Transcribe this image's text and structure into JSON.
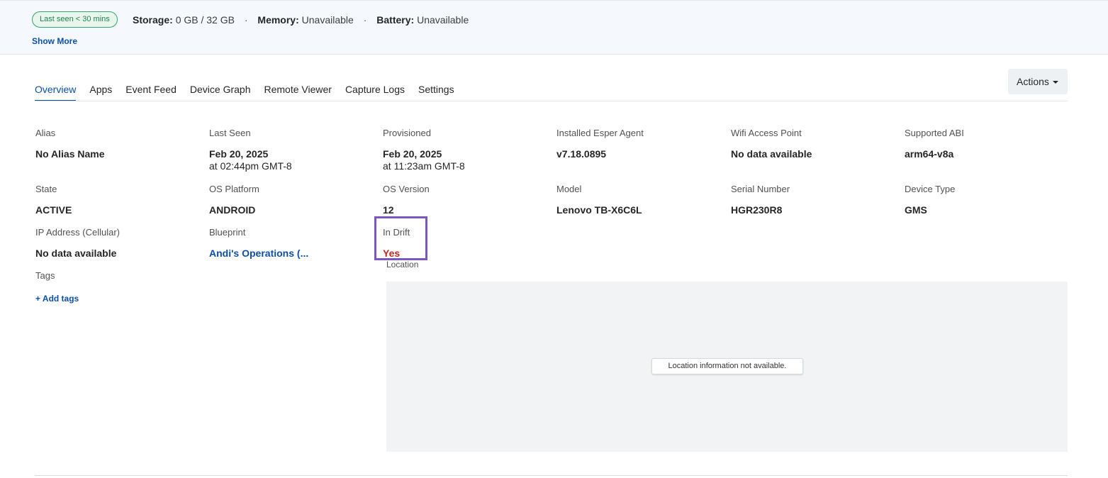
{
  "status_bar": {
    "badge": "Last seen < 30 mins",
    "storage_label": "Storage:",
    "storage_value": "0 GB / 32 GB",
    "memory_label": "Memory:",
    "memory_value": "Unavailable",
    "battery_label": "Battery:",
    "battery_value": "Unavailable",
    "separator": "·",
    "show_more": "Show More"
  },
  "tabs": [
    {
      "label": "Overview",
      "active": true
    },
    {
      "label": "Apps"
    },
    {
      "label": "Event Feed"
    },
    {
      "label": "Device Graph"
    },
    {
      "label": "Remote Viewer"
    },
    {
      "label": "Capture Logs"
    },
    {
      "label": "Settings"
    }
  ],
  "actions_label": "Actions",
  "details": {
    "alias": {
      "label": "Alias",
      "value": "No Alias Name"
    },
    "last_seen": {
      "label": "Last Seen",
      "value": "Feb 20, 2025",
      "sub": "at 02:44pm GMT-8"
    },
    "provisioned": {
      "label": "Provisioned",
      "value": "Feb 20, 2025",
      "sub": "at 11:23am GMT-8"
    },
    "agent": {
      "label": "Installed Esper Agent",
      "value": "v7.18.0895"
    },
    "wifi": {
      "label": "Wifi Access Point",
      "value": "No data available"
    },
    "abi": {
      "label": "Supported ABI",
      "value": "arm64-v8a"
    },
    "state": {
      "label": "State",
      "value": "ACTIVE"
    },
    "os_platform": {
      "label": "OS Platform",
      "value": "ANDROID"
    },
    "os_version": {
      "label": "OS Version",
      "value": "12"
    },
    "model": {
      "label": "Model",
      "value": "Lenovo TB-X6C6L"
    },
    "serial": {
      "label": "Serial Number",
      "value": "HGR230R8"
    },
    "device_type": {
      "label": "Device Type",
      "value": "GMS"
    },
    "ip": {
      "label": "IP Address (Cellular)",
      "value": "No data available"
    },
    "blueprint": {
      "label": "Blueprint",
      "value": "Andi's Operations (..."
    },
    "in_drift": {
      "label": "In Drift",
      "value": "Yes"
    },
    "tags": {
      "label": "Tags",
      "add": "+ Add tags"
    },
    "location": {
      "label": "Location",
      "message": "Location information not available."
    }
  },
  "colors": {
    "accent": "#0b4fa8",
    "drift_red": "#c0261b",
    "highlight": "#7b57c4",
    "badge_green": "#35a56a"
  }
}
